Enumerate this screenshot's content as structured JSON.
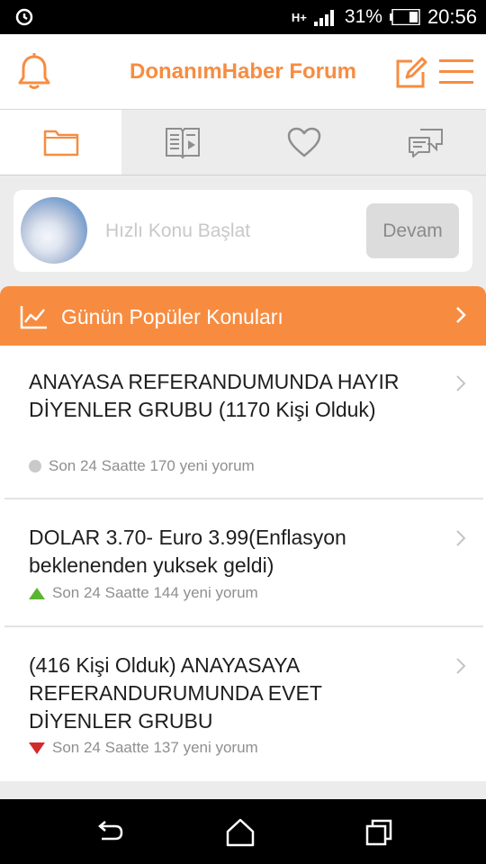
{
  "status_bar": {
    "network": "H+",
    "battery": "31%",
    "time": "20:56"
  },
  "header": {
    "title": "DonanımHaber Forum"
  },
  "quick_topic": {
    "placeholder": "Hızlı Konu Başlat",
    "button": "Devam"
  },
  "popular": {
    "title": "Günün Popüler Konuları"
  },
  "topics": [
    {
      "title": "ANAYASA REFERANDUMUNDA HAYIR DİYENLER GRUBU (1170 Kişi Olduk)",
      "meta": "Son 24 Saatte 170 yeni yorum",
      "trend": "neutral"
    },
    {
      "title": "DOLAR 3.70- Euro 3.99(Enflasyon beklenenden yuksek geldi)",
      "meta": "Son 24 Saatte 144 yeni yorum",
      "trend": "up"
    },
    {
      "title": "(416 Kişi Olduk) ANAYASAYA REFERANDURUMUNDA EVET DİYENLER GRUBU",
      "meta": "Son 24 Saatte 137 yeni yorum",
      "trend": "down"
    }
  ],
  "colors": {
    "accent": "#f78c40",
    "trend_up": "#5ab52f",
    "trend_down": "#d12b2b"
  },
  "icons": {
    "tabs": [
      "folder-icon",
      "book-icon",
      "heart-icon",
      "chat-icon"
    ],
    "nav": [
      "back-icon",
      "home-icon",
      "recents-icon"
    ]
  }
}
